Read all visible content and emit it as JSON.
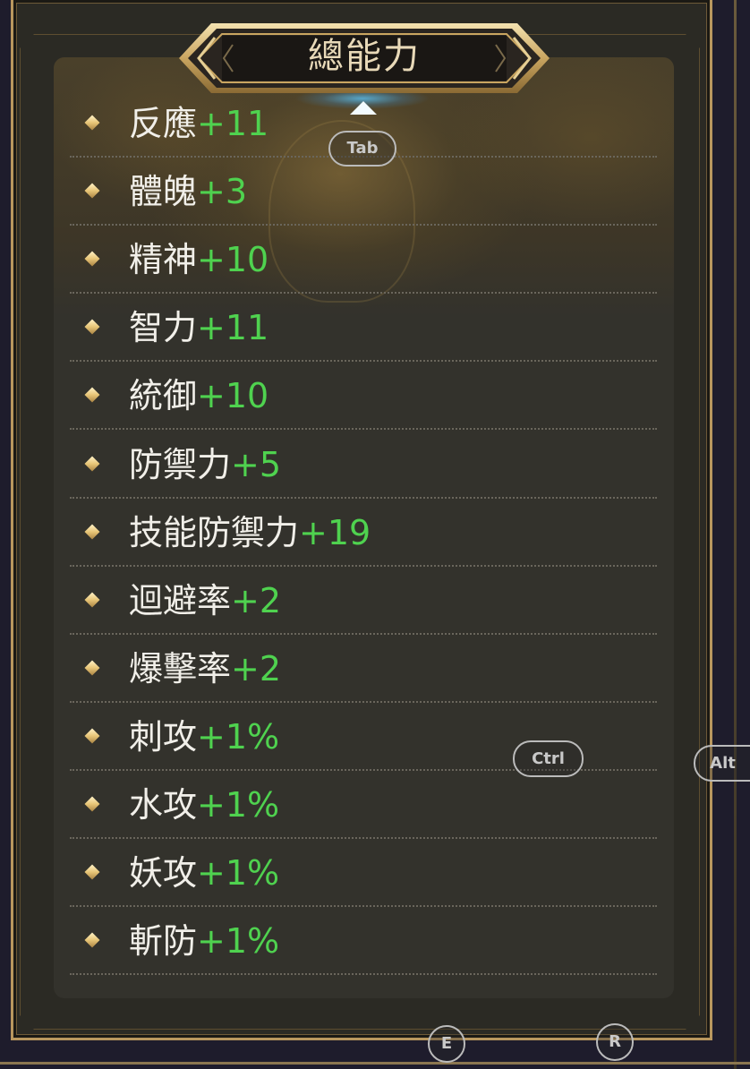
{
  "panel": {
    "title": "總能力"
  },
  "stats": [
    {
      "name": "反應",
      "value": "+11"
    },
    {
      "name": "體魄",
      "value": "+3"
    },
    {
      "name": "精神",
      "value": "+10"
    },
    {
      "name": "智力",
      "value": "+11"
    },
    {
      "name": "統御",
      "value": "+10"
    },
    {
      "name": "防禦力",
      "value": "+5"
    },
    {
      "name": "技能防禦力",
      "value": "+19"
    },
    {
      "name": "迴避率",
      "value": "+2"
    },
    {
      "name": "爆擊率",
      "value": "+2"
    },
    {
      "name": "刺攻",
      "value": "+1%"
    },
    {
      "name": "水攻",
      "value": "+1%"
    },
    {
      "name": "妖攻",
      "value": "+1%"
    },
    {
      "name": "斬防",
      "value": "+1%"
    }
  ],
  "key_hints": {
    "tab": "Tab",
    "ctrl": "Ctrl",
    "alt": "Alt",
    "e": "E",
    "r": "R"
  },
  "colors": {
    "stat_value": "#4fd24f",
    "frame_gold": "#b9975e",
    "panel_bg": "#33322c"
  },
  "icons": {
    "stat_bullet": "diamond-bullet-icon",
    "expand_caret": "caret-up-icon"
  }
}
